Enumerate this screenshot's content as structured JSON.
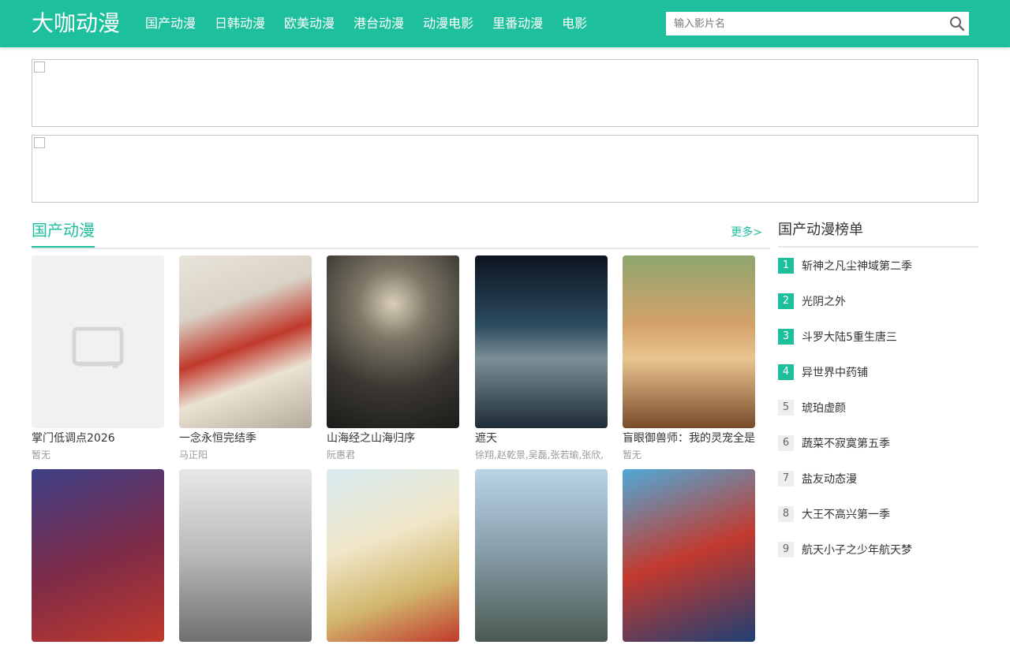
{
  "site": {
    "logo": "大咖动漫"
  },
  "nav": [
    {
      "label": "国产动漫"
    },
    {
      "label": "日韩动漫"
    },
    {
      "label": "欧美动漫"
    },
    {
      "label": "港台动漫"
    },
    {
      "label": "动漫电影"
    },
    {
      "label": "里番动漫"
    },
    {
      "label": "电影"
    }
  ],
  "search": {
    "placeholder": "输入影片名",
    "value": ""
  },
  "section": {
    "title": "国产动漫",
    "more": "更多>"
  },
  "cards": [
    {
      "title": "掌门低调点2026",
      "sub": "暂无",
      "poster": "placeholder"
    },
    {
      "title": "一念永恒完结季",
      "sub": "马正阳",
      "poster": "art"
    },
    {
      "title": "山海经之山海归序",
      "sub": "阮惠君",
      "poster": "art"
    },
    {
      "title": "遮天",
      "sub": "徐翔,赵乾景,吴磊,张若瑜,张欣,",
      "poster": "art"
    },
    {
      "title": "盲眼御兽师：我的灵宠全是",
      "sub": "暂无",
      "poster": "art"
    },
    {
      "title": "",
      "sub": "",
      "poster": "art"
    },
    {
      "title": "",
      "sub": "",
      "poster": "art"
    },
    {
      "title": "",
      "sub": "",
      "poster": "art"
    },
    {
      "title": "",
      "sub": "",
      "poster": "art"
    },
    {
      "title": "",
      "sub": "",
      "poster": "art"
    }
  ],
  "rank": {
    "title": "国产动漫榜单",
    "items": [
      {
        "num": "1",
        "name": "斩神之凡尘神域第二季"
      },
      {
        "num": "2",
        "name": "光阴之外"
      },
      {
        "num": "3",
        "name": "斗罗大陆5重生唐三"
      },
      {
        "num": "4",
        "name": "异世界中药铺"
      },
      {
        "num": "5",
        "name": "琥珀虚颜"
      },
      {
        "num": "6",
        "name": "蔬菜不寂寞第五季"
      },
      {
        "num": "7",
        "name": "盐友动态漫"
      },
      {
        "num": "8",
        "name": "大王不高兴第一季"
      },
      {
        "num": "9",
        "name": "航天小子之少年航天梦"
      }
    ]
  },
  "colors": {
    "accent": "#1dbf9c"
  }
}
